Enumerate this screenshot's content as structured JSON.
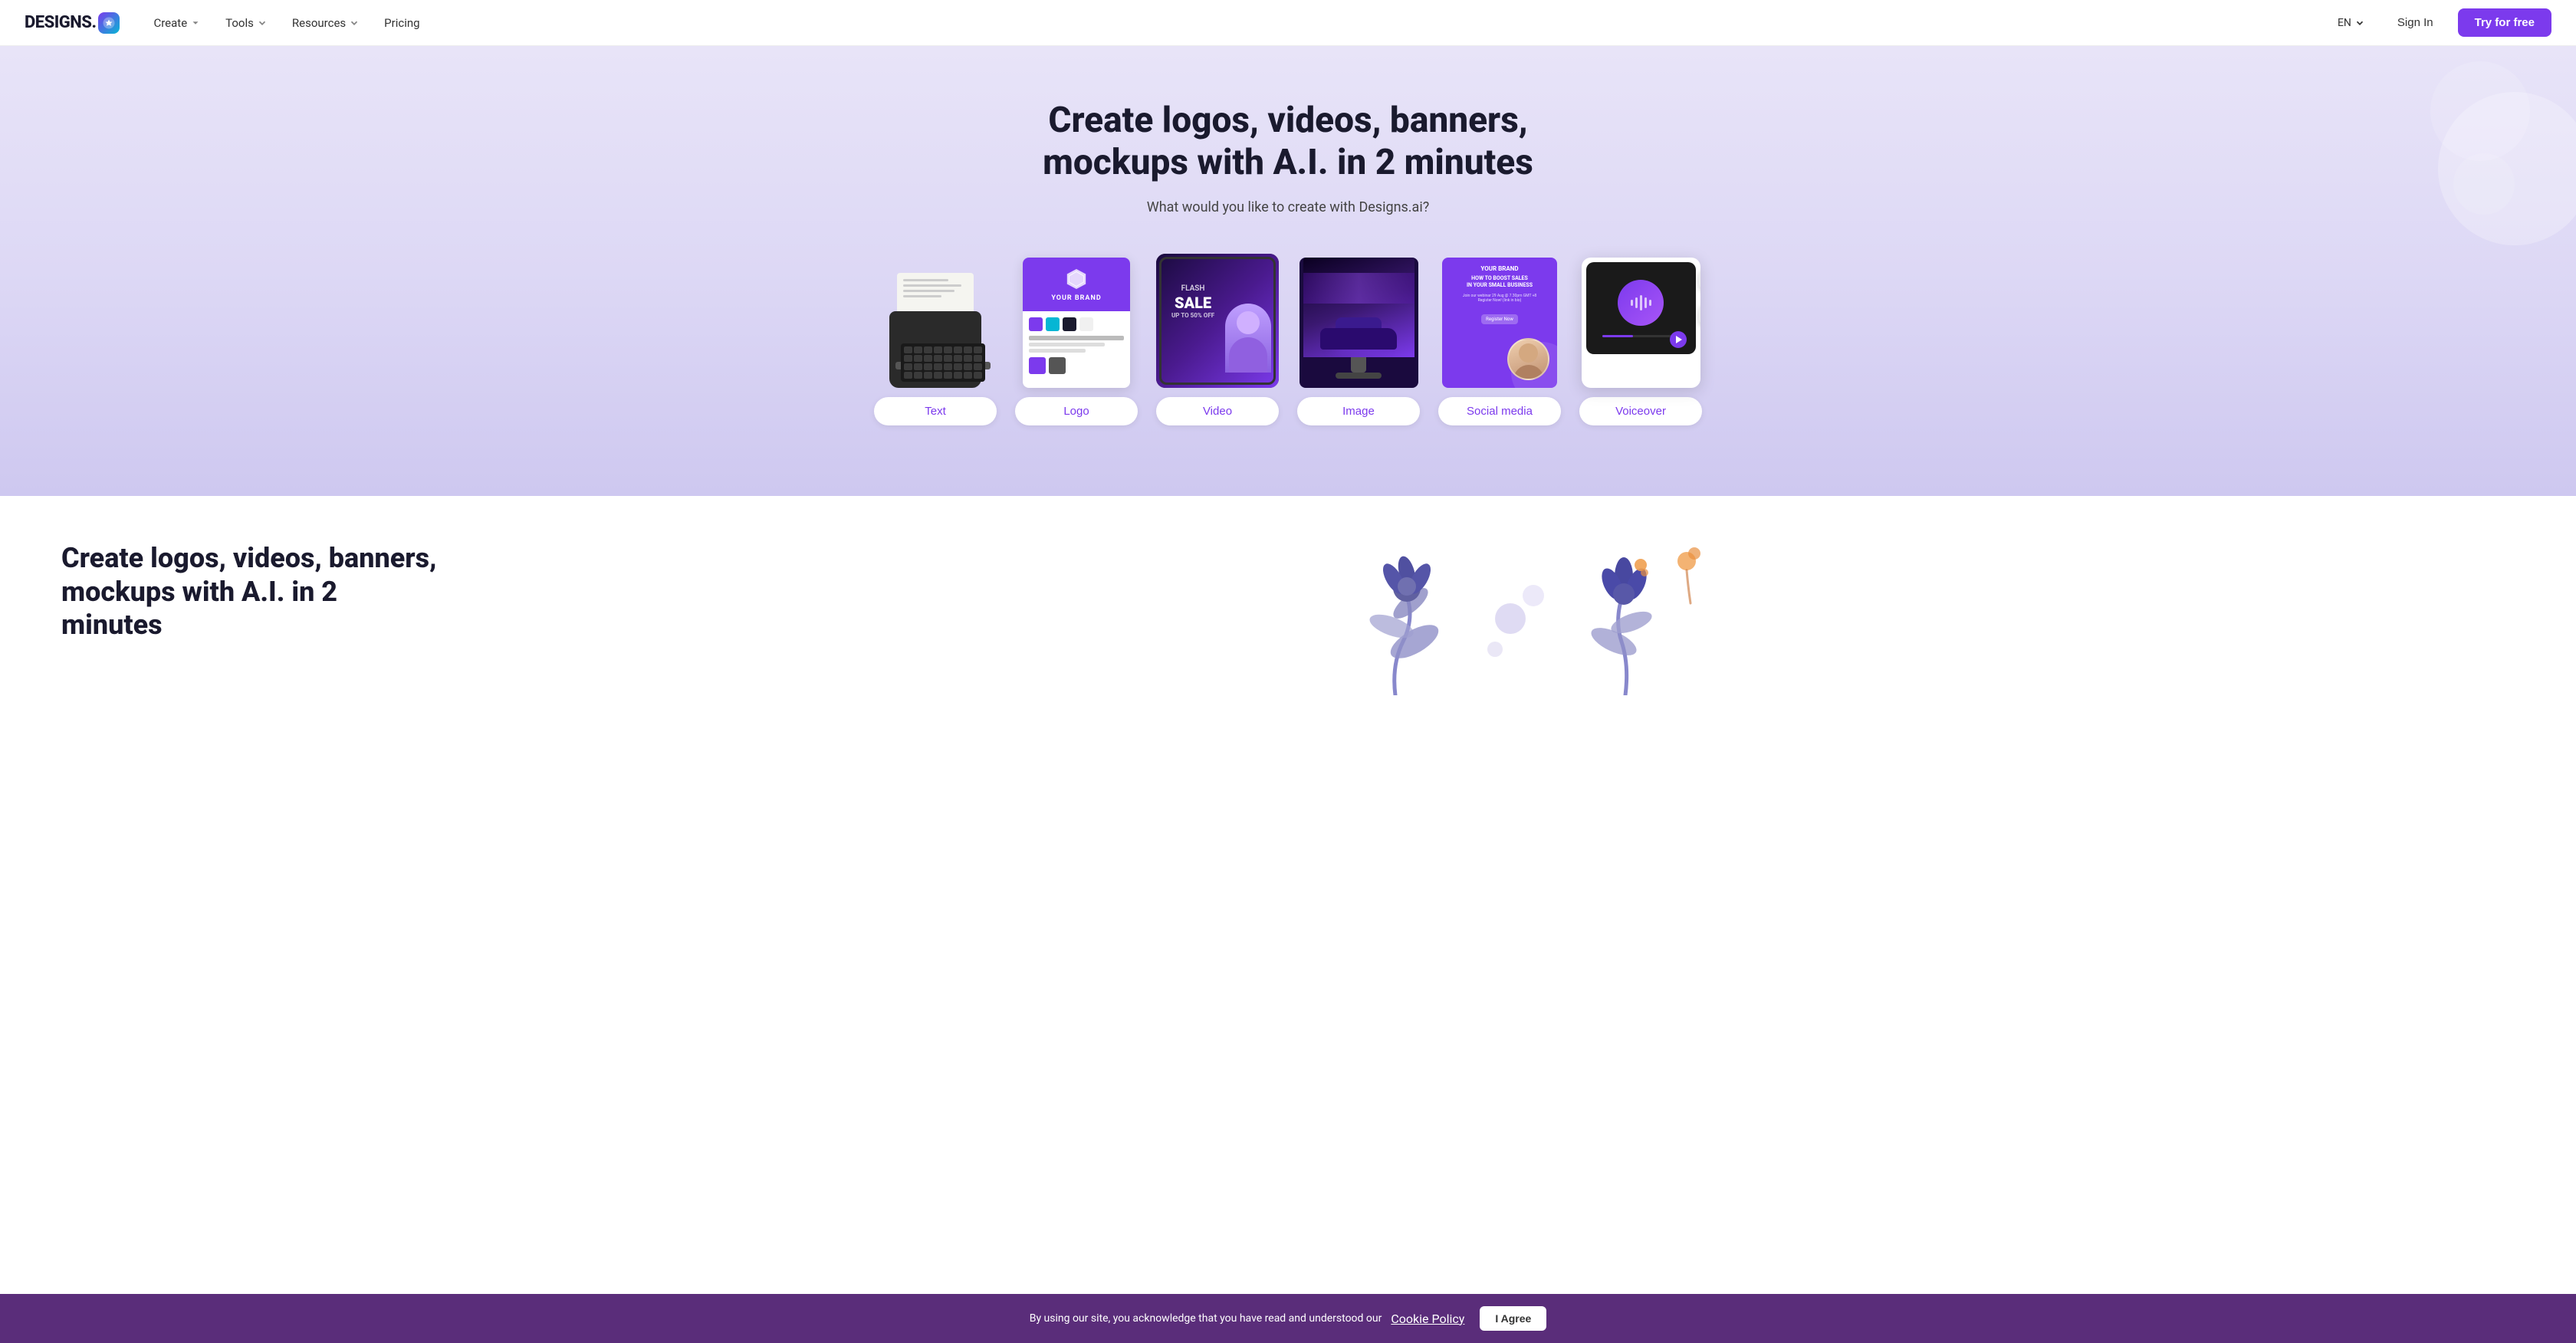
{
  "brand": {
    "name": "DESIGNS.",
    "badge_label": "AI"
  },
  "nav": {
    "create_label": "Create",
    "tools_label": "Tools",
    "resources_label": "Resources",
    "pricing_label": "Pricing",
    "lang_label": "EN",
    "signin_label": "Sign In",
    "try_label": "Try for free"
  },
  "hero": {
    "heading": "Create logos, videos, banners, mockups with A.I. in 2 minutes",
    "subtitle": "What would you like to create with Designs.ai?",
    "cards": [
      {
        "id": "text",
        "label": "Text"
      },
      {
        "id": "logo",
        "label": "Logo"
      },
      {
        "id": "video",
        "label": "Video"
      },
      {
        "id": "image",
        "label": "Image"
      },
      {
        "id": "social",
        "label": "Social media"
      },
      {
        "id": "voiceover",
        "label": "Voiceover"
      }
    ]
  },
  "second_section": {
    "heading": "Create logos, videos, banners, mockups with A.I. in 2 minutes"
  },
  "cookie": {
    "text": "By using our site, you acknowledge that you have read and understood our",
    "link_text": "Cookie Policy",
    "agree_label": "I Agree"
  },
  "colors": {
    "purple": "#7c3aed",
    "dark": "#1a1a2e",
    "hero_bg": "#e8e4f8",
    "cookie_bg": "#5a2d7a"
  }
}
